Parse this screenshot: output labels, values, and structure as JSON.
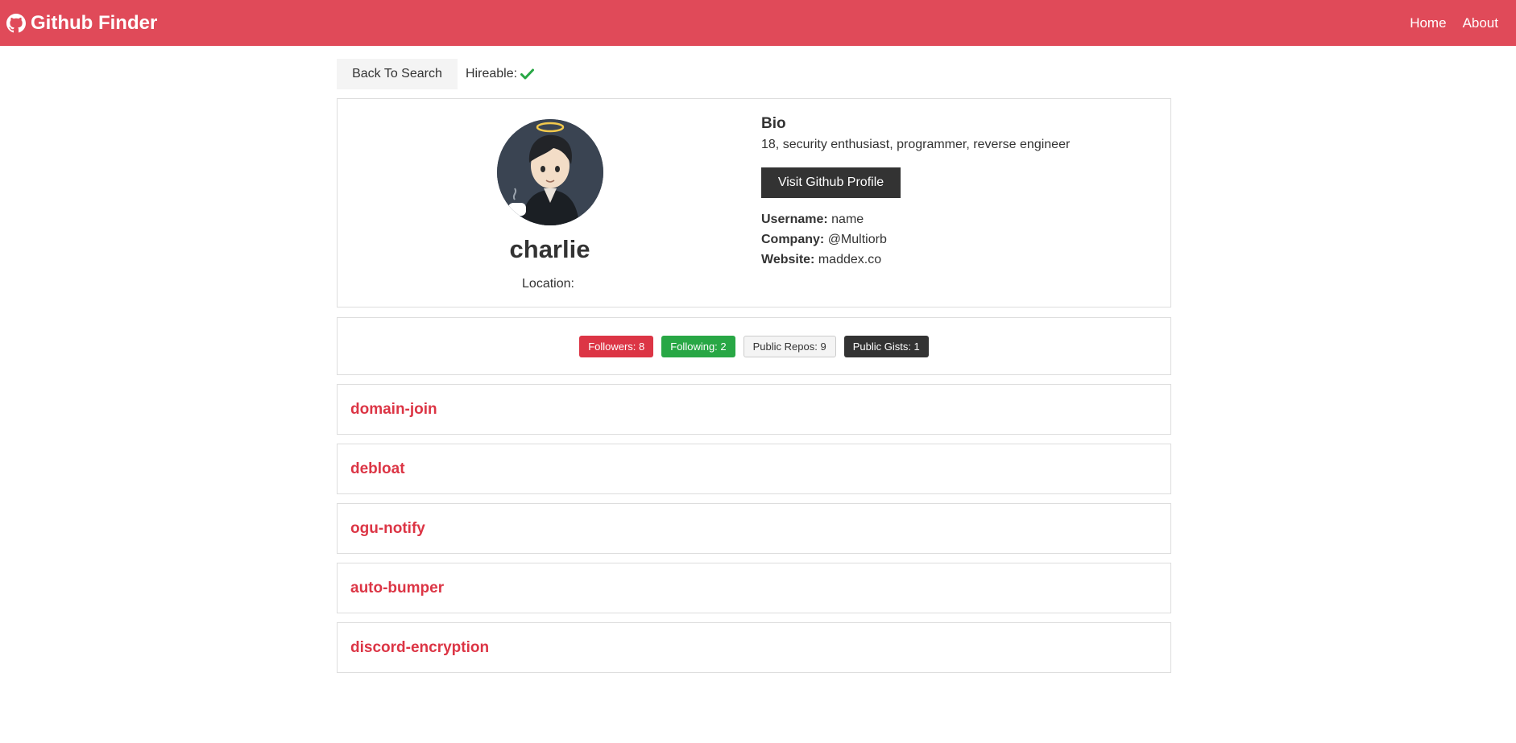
{
  "navbar": {
    "brand": "Github Finder",
    "links": [
      "Home",
      "About"
    ]
  },
  "toolbar": {
    "back_label": "Back To Search",
    "hireable_label": "Hireable:"
  },
  "profile": {
    "name": "charlie",
    "location_label": "Location:",
    "location_value": "",
    "bio_title": "Bio",
    "bio": "18, security enthusiast, programmer, reverse engineer",
    "visit_label": "Visit Github Profile",
    "username_label": "Username:",
    "username": "name",
    "company_label": "Company:",
    "company": "@Multiorb",
    "website_label": "Website:",
    "website": "maddex.co"
  },
  "badges": {
    "followers": "Followers: 8",
    "following": "Following: 2",
    "repos": "Public Repos: 9",
    "gists": "Public Gists: 1"
  },
  "repos": [
    "domain-join",
    "debloat",
    "ogu-notify",
    "auto-bumper",
    "discord-encryption"
  ],
  "colors": {
    "navbar": "#e04a59",
    "primary_red": "#dc3545",
    "success_green": "#28a745",
    "dark": "#333333",
    "light": "#f4f4f4"
  },
  "icons": {
    "brand": "github-icon",
    "hireable": "check-icon"
  }
}
